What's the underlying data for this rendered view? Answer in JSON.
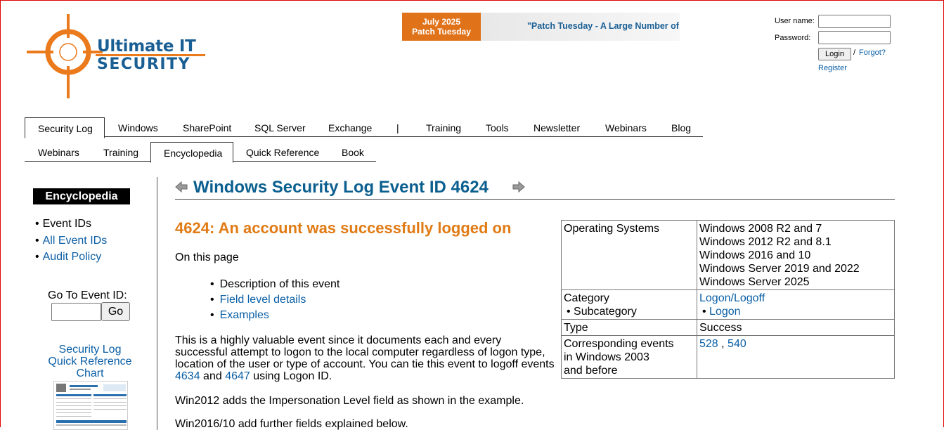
{
  "logo": {
    "line1": "Ultimate IT",
    "line2": "SECURITY"
  },
  "banner": {
    "tag_line1": "July 2025",
    "tag_line2": "Patch Tuesday",
    "text": "\"Patch Tuesday - A Large Number of"
  },
  "login": {
    "username_label": "User name:",
    "password_label": "Password:",
    "login_button": "Login",
    "slash": "/",
    "forgot": "Forgot?",
    "register": "Register"
  },
  "nav1": [
    "Security Log",
    "Windows",
    "SharePoint",
    "SQL Server",
    "Exchange",
    "|",
    "Training",
    "Tools",
    "Newsletter",
    "Webinars",
    "Blog"
  ],
  "nav2": [
    "Webinars",
    "Training",
    "Encyclopedia",
    "Quick Reference",
    "Book"
  ],
  "sidebar": {
    "title": "Encyclopedia",
    "items": [
      "Event IDs",
      "All Event IDs",
      "Audit Policy"
    ],
    "goto_label": "Go To Event ID:",
    "goto_button": "Go",
    "qref_line1": "Security Log",
    "qref_line2": "Quick Reference",
    "qref_line3": "Chart"
  },
  "main": {
    "title": "Windows Security Log Event ID 4624",
    "event_heading": "4624: An account was successfully logged on",
    "on_this_page": "On this page",
    "toc": [
      "Description of this event",
      "Field level details",
      "Examples"
    ],
    "para1_a": "This is a highly valuable event since it documents each and every successful attempt to logon to the local computer regardless of logon type, location of the user or type of account.  You can tie this event to logoff events ",
    "para1_link1": "4634",
    "para1_and": " and ",
    "para1_link2": "4647",
    "para1_b": " using Logon ID.",
    "para2": "Win2012 adds the Impersonation Level field as shown in the example.",
    "para3": "Win2016/10 add further fields explained below."
  },
  "info": {
    "os_label": "Operating Systems",
    "os_values": [
      "Windows 2008 R2 and 7",
      "Windows 2012 R2 and 8.1",
      "Windows 2016 and 10",
      "Windows Server 2019 and 2022",
      "Windows Server 2025"
    ],
    "category_label": "Category",
    "subcategory_label": "Subcategory",
    "category_value": "Logon/Logoff",
    "subcategory_value": "Logon",
    "type_label": "Type",
    "type_value": "Success",
    "corr_label_1": "Corresponding events",
    "corr_label_2": "in Windows 2003",
    "corr_label_3": "and before",
    "corr_link1": "528",
    "corr_sep": " , ",
    "corr_link2": "540"
  },
  "colors": {
    "accent_orange": "#e07b15",
    "brand_blue": "#1a5f94",
    "link_blue": "#0b5fa5"
  }
}
